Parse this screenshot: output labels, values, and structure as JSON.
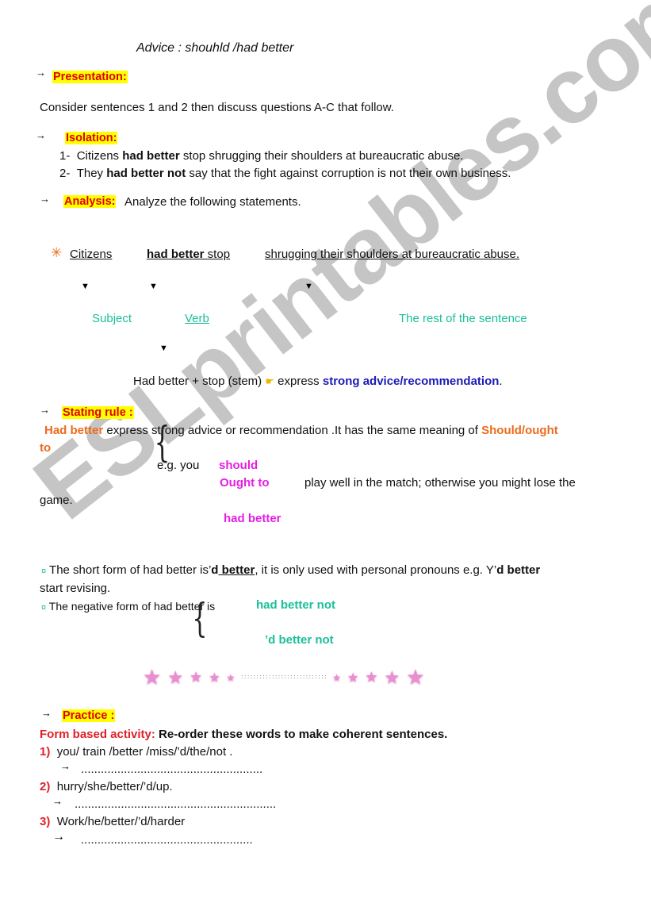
{
  "title": "Advice : shouhld /had better",
  "presentation": {
    "heading": "Presentation:",
    "instruction": "Consider sentences 1 and 2 then discuss questions A-C that follow."
  },
  "isolation": {
    "heading": "Isolation:",
    "sentences": [
      {
        "num": "1-",
        "pre": "Citizens ",
        "bold": "had better",
        "post": " stop shrugging their shoulders at bureaucratic abuse."
      },
      {
        "num": "2-",
        "pre": "They ",
        "bold": "had better not",
        "post": " say that the fight against corruption is not their own business."
      }
    ]
  },
  "analysis": {
    "heading": "Analysis:",
    "instruction": "Analyze the following statements.",
    "subject_part": "Citizens",
    "verb_bold": "had better",
    "verb_rest": " stop",
    "rest_part": "shrugging their shoulders at bureaucratic abuse.",
    "labels": {
      "subject": "Subject",
      "verb": "Verb",
      "rest": "The rest of the sentence"
    },
    "formula": "Had better + stop (stem)",
    "formula_express": "express ",
    "formula_highlight": "strong advice/recommendation",
    "formula_end": "."
  },
  "rule": {
    "heading": "Stating rule :",
    "line1_lead": "Had better",
    "line1_text": " express strong advice or recommendation .It has the same meaning of ",
    "line1_orange": "Should/ought",
    "line1_cont": "to",
    "example_prefix": "e.g. you",
    "modal_options": [
      "should",
      "Ought to",
      "had better"
    ],
    "example_rest": "play well in the match; otherwise you might lose the",
    "example_end": "game.",
    "short_form_a": "The short form of had better is’",
    "short_form_bold": "d",
    "short_form_u": " better",
    "short_form_b": ", it is only used with personal pronouns e.g. Y’",
    "short_form_bold2": "d better",
    "short_form_end": "start revising.",
    "negative_text": "The negative form of had better is",
    "negative_options": [
      "had better not",
      "’d better not"
    ]
  },
  "practice": {
    "heading": "Practice :",
    "activity_label": "Form based activity:",
    "activity_instruction": " Re-order these words to make coherent sentences.",
    "items": [
      {
        "num": "1)",
        "words": "you/ train /better /miss/’d/the/not .",
        "answer": "......................................................."
      },
      {
        "num": "2)",
        "words": "hurry/she/better/’d/up.",
        "answer": "............................................................."
      },
      {
        "num": "3)",
        "words": "Work/he/better/’d/harder",
        "answer": "...................................................."
      }
    ]
  },
  "divider_dots": ": : : : : : : : : : : : : : : : : : : : : : : : : : : :",
  "watermark": "ESLprintables.com",
  "icons": {
    "arrow": "→",
    "triangle": "▼",
    "asterisk": "✳",
    "pointing_hand": "☛",
    "bullet": "¤",
    "star": "★"
  }
}
